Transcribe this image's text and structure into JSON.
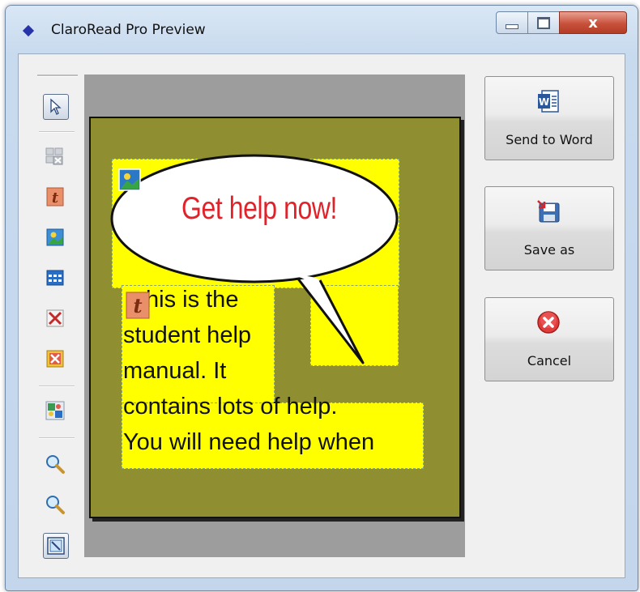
{
  "window": {
    "title": "ClaroRead Pro Preview",
    "controls": {
      "minimize": "minimize",
      "maximize": "maximize",
      "close": "x"
    }
  },
  "toolbar": {
    "tools": [
      {
        "name": "select-pointer-icon",
        "active": true
      },
      {
        "name": "grouped-delete-icon",
        "active": false
      },
      {
        "name": "add-text-icon",
        "active": false
      },
      {
        "name": "add-image-icon",
        "active": false
      },
      {
        "name": "add-table-icon",
        "active": false
      },
      {
        "name": "delete-icon",
        "active": false
      },
      {
        "name": "delete-all-icon",
        "active": false
      },
      {
        "name": "layout-icon",
        "active": false
      },
      {
        "name": "zoom-in-icon",
        "active": false
      },
      {
        "name": "zoom-out-icon",
        "active": false
      },
      {
        "name": "fit-page-icon",
        "active": true
      }
    ]
  },
  "preview": {
    "speech_bubble_text": "Get help now!",
    "body_lines": [
      "his is the",
      "student help",
      "manual. It",
      "contains lots of help.",
      "You will need help when"
    ],
    "colors": {
      "page": "#8f8f32",
      "highlight": "#ffff00",
      "speech_text": "#e0232b"
    }
  },
  "actions": {
    "send_to_word": "Send to Word",
    "save_as": "Save as",
    "cancel": "Cancel"
  }
}
